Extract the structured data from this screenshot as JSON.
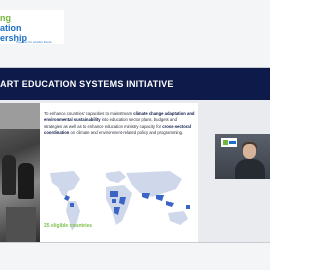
{
  "logo": {
    "line1": "ng",
    "line2": "ation",
    "line3": "ership",
    "tagline": "Together for a better future"
  },
  "slide": {
    "title": "ART EDUCATION SYSTEMS INITIATIVE",
    "body": {
      "s1": "To enhance countries' capacities to mainstream ",
      "b1": "climate change adaptation and environmental sustainability",
      "s2": " into education sector plans, budgets and strategies as well as to enhance education ministry capacity for ",
      "b2": "cross-sectoral coordination",
      "s3": " on climate and environment-related policy and programming."
    },
    "map_label": "25 eligible countries"
  },
  "colors": {
    "header_navy": "#0d1a4a",
    "accent_green": "#7cc04a",
    "map_highlight": "#3a64c6",
    "map_base": "#cfd8ea"
  },
  "speaker": {
    "icon": "person-video-icon"
  }
}
